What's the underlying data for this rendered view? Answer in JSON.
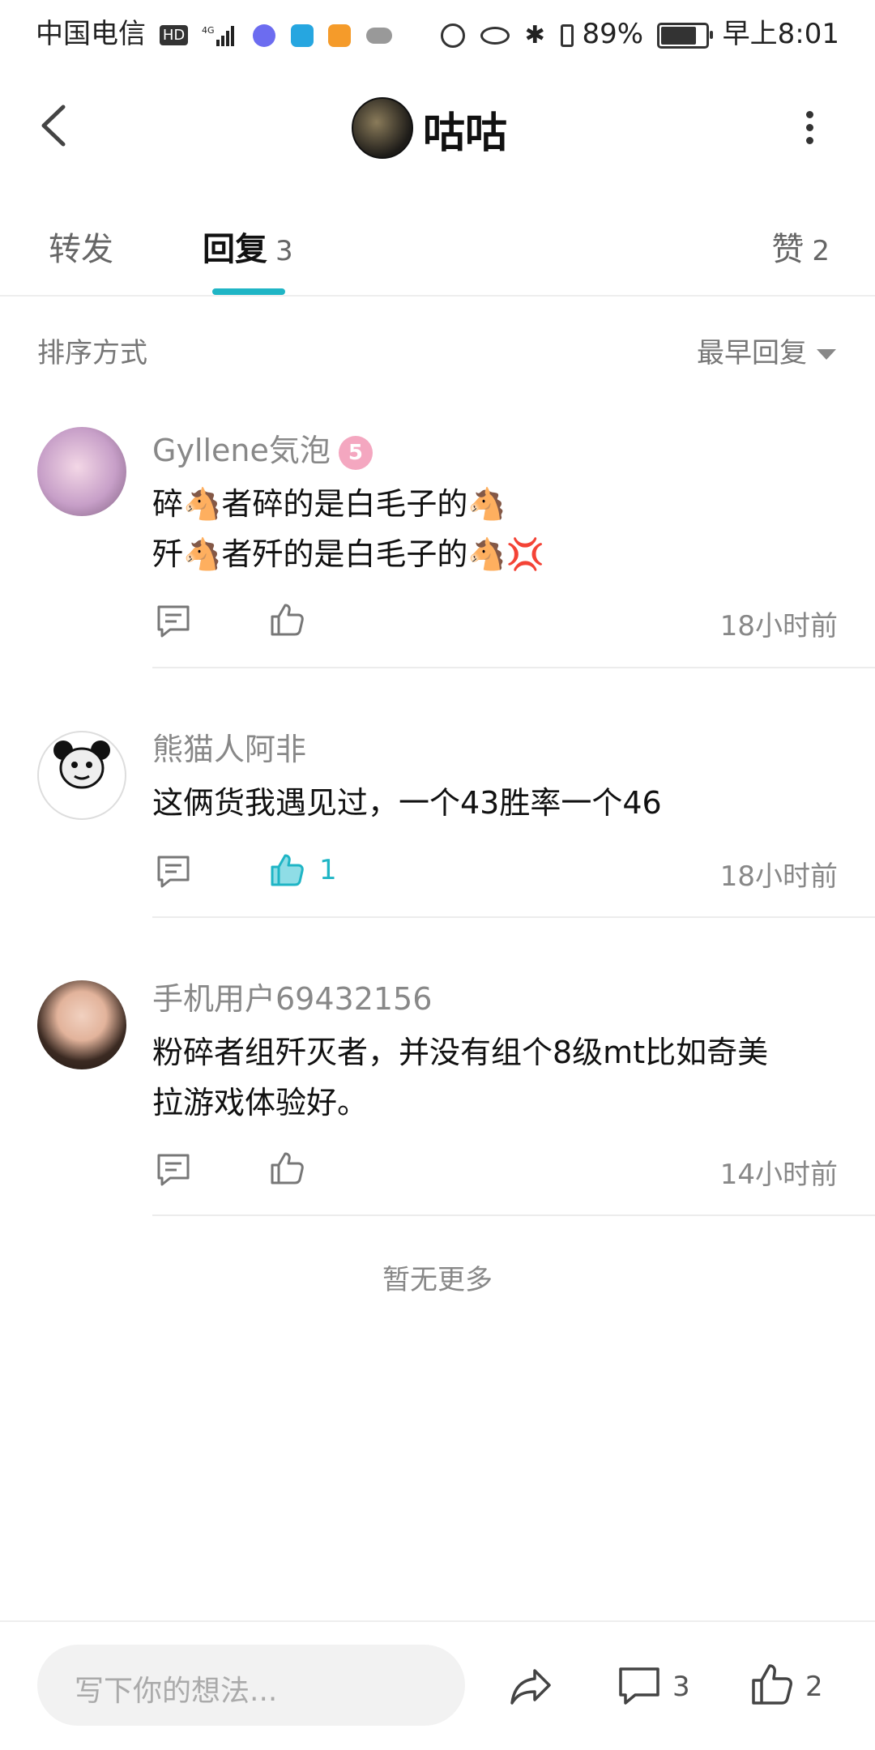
{
  "status_bar": {
    "carrier": "中国电信",
    "hd": "HD",
    "network": "4G",
    "battery_percent": "89%",
    "battery_level": 0.89,
    "time": "早上8:01"
  },
  "header": {
    "title": "咕咕"
  },
  "tabs": [
    {
      "label": "转发",
      "count": ""
    },
    {
      "label": "回复",
      "count": "3"
    },
    {
      "label": "赞",
      "count": "2"
    }
  ],
  "sort": {
    "label": "排序方式",
    "value": "最早回复"
  },
  "comments": [
    {
      "name": "Gyllene気泡",
      "badge": "5",
      "lines": [
        "碎🐴者碎的是白毛子的🐴",
        "歼🐴者歼的是白毛子的🐴💢"
      ],
      "like_count": "",
      "liked": false,
      "time": "18小时前"
    },
    {
      "name": "熊猫人阿非",
      "lines": [
        "这俩货我遇见过，一个43胜率一个46"
      ],
      "like_count": "1",
      "liked": true,
      "time": "18小时前"
    },
    {
      "name": "手机用户69432156",
      "lines": [
        "粉碎者组歼灭者，并没有组个8级mt比如奇美",
        "拉游戏体验好。"
      ],
      "like_count": "",
      "liked": false,
      "time": "14小时前"
    }
  ],
  "no_more": "暂无更多",
  "bottom_bar": {
    "input_placeholder": "写下你的想法...",
    "comment_count": "3",
    "like_count": "2"
  },
  "colors": {
    "accent": "#1fb5c5",
    "muted_text": "#888888",
    "separator": "#ececec"
  },
  "icons": [
    "back-icon",
    "more-icon",
    "comment-icon",
    "like-icon",
    "share-icon",
    "caret-down-icon"
  ]
}
